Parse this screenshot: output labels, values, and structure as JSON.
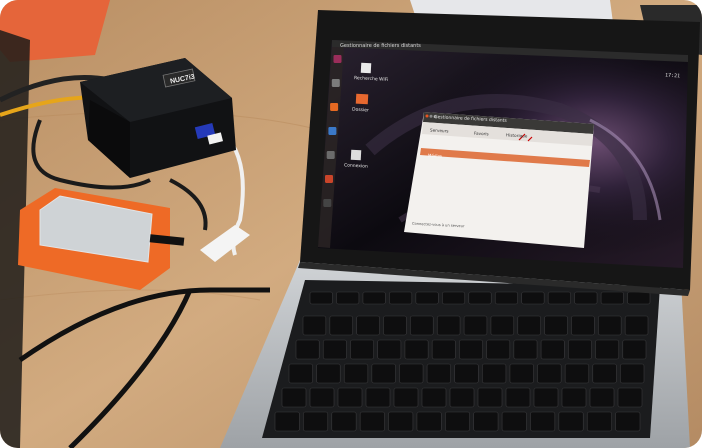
{
  "scene": {
    "description_colors": {
      "desk": "#c9a57c",
      "laptop_body": "#b9bcc0",
      "drive_orange": "#ef6a26",
      "screen_bg": "#141018"
    }
  },
  "device": {
    "nuc_label": "NUC7i3"
  },
  "screen": {
    "top_bar_title": "Gestionnaire de fichiers distants",
    "clock": "17:21",
    "launcher_icons": [
      "dash-icon",
      "files-icon",
      "firefox-icon",
      "libreoffice-icon",
      "settings-icon",
      "software-icon",
      "terminal-icon"
    ],
    "desktop_icons": [
      {
        "label": "Recherche WiFi"
      },
      {
        "label": "Dossier"
      },
      {
        "label": "Connexion"
      }
    ]
  },
  "file_window": {
    "title": "Gestionnaire de fichiers distants",
    "toolbar_tabs": [
      "Serveurs",
      "Favoris",
      "Historique"
    ],
    "selected_row": "Médias",
    "status": "Connectez-vous à un serveur"
  }
}
